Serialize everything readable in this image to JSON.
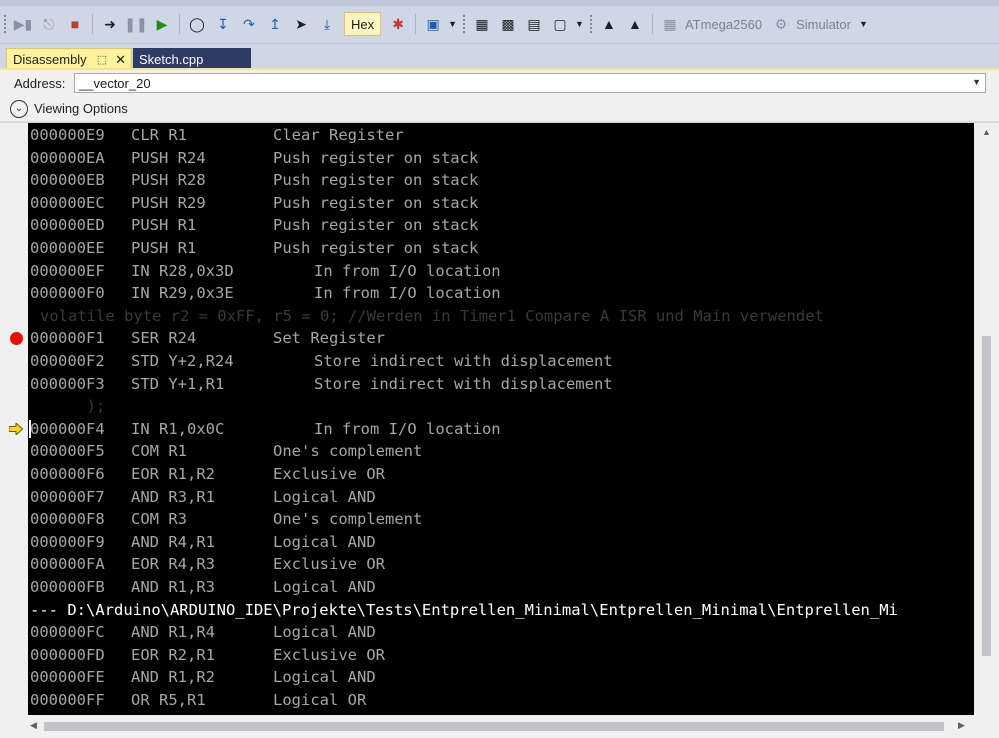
{
  "toolbar": {
    "hex_label": "Hex",
    "device": "ATmega2560",
    "tool": "Simulator",
    "icons": [
      "restart-icon",
      "step-icon",
      "stop-icon",
      "show-next-statement-icon",
      "pause-icon",
      "continue-icon",
      "watch-icon",
      "step-into-icon",
      "step-over-icon",
      "step-out-icon",
      "run-to-cursor-icon",
      "run-to-line-icon",
      "hex-toggle",
      "breakpoints-icon",
      "window-icon",
      "memory-icon",
      "registers-icon",
      "processor-icon",
      "io-view-icon",
      "program-icon",
      "erase-icon",
      "device-icon"
    ]
  },
  "tabs": [
    {
      "label": "Disassembly",
      "active": true
    },
    {
      "label": "Sketch.cpp",
      "active": false
    }
  ],
  "address": {
    "label": "Address:",
    "value": "__vector_20"
  },
  "viewing_options": {
    "label": "Viewing Options"
  },
  "lines": [
    {
      "type": "asm",
      "addr": "000000E9",
      "ins": "CLR R1",
      "desc": "Clear Register",
      "desc_col": "short"
    },
    {
      "type": "asm",
      "addr": "000000EA",
      "ins": "PUSH R24",
      "desc": "Push register on stack",
      "desc_col": "short"
    },
    {
      "type": "asm",
      "addr": "000000EB",
      "ins": "PUSH R28",
      "desc": "Push register on stack",
      "desc_col": "short"
    },
    {
      "type": "asm",
      "addr": "000000EC",
      "ins": "PUSH R29",
      "desc": "Push register on stack",
      "desc_col": "short"
    },
    {
      "type": "asm",
      "addr": "000000ED",
      "ins": "PUSH R1",
      "desc": "Push register on stack",
      "desc_col": "short"
    },
    {
      "type": "asm",
      "addr": "000000EE",
      "ins": "PUSH R1",
      "desc": "Push register on stack",
      "desc_col": "short"
    },
    {
      "type": "asm",
      "addr": "000000EF",
      "ins": "IN R28,0x3D",
      "desc": "In from I/O location",
      "desc_col": "long"
    },
    {
      "type": "asm",
      "addr": "000000F0",
      "ins": "IN R29,0x3E",
      "desc": "In from I/O location",
      "desc_col": "long"
    },
    {
      "type": "source",
      "text": "volatile byte r2 = 0xFF, r5 = 0; //Werden in Timer1 Compare A ISR und Main verwendet"
    },
    {
      "type": "asm",
      "addr": "000000F1",
      "ins": "SER R24",
      "desc": "Set Register",
      "desc_col": "short",
      "breakpoint": true
    },
    {
      "type": "asm",
      "addr": "000000F2",
      "ins": "STD Y+2,R24",
      "desc": "Store indirect with displacement",
      "desc_col": "long"
    },
    {
      "type": "asm",
      "addr": "000000F3",
      "ins": "STD Y+1,R1",
      "desc": "Store indirect with displacement",
      "desc_col": "long"
    },
    {
      "type": "source",
      "text": "     );"
    },
    {
      "type": "asm",
      "addr": "000000F4",
      "ins": "IN R1,0x0C",
      "desc": "In from I/O location",
      "desc_col": "long",
      "current": true
    },
    {
      "type": "asm",
      "addr": "000000F5",
      "ins": "COM R1",
      "desc": "One's complement",
      "desc_col": "short"
    },
    {
      "type": "asm",
      "addr": "000000F6",
      "ins": "EOR R1,R2",
      "desc": "Exclusive OR",
      "desc_col": "short"
    },
    {
      "type": "asm",
      "addr": "000000F7",
      "ins": "AND R3,R1",
      "desc": "Logical AND",
      "desc_col": "short"
    },
    {
      "type": "asm",
      "addr": "000000F8",
      "ins": "COM R3",
      "desc": "One's complement",
      "desc_col": "short"
    },
    {
      "type": "asm",
      "addr": "000000F9",
      "ins": "AND R4,R1",
      "desc": "Logical AND",
      "desc_col": "short"
    },
    {
      "type": "asm",
      "addr": "000000FA",
      "ins": "EOR R4,R3",
      "desc": "Exclusive OR",
      "desc_col": "short"
    },
    {
      "type": "asm",
      "addr": "000000FB",
      "ins": "AND R1,R3",
      "desc": "Logical AND",
      "desc_col": "short"
    },
    {
      "type": "file",
      "text": "--- D:\\Arduino\\ARDUINO_IDE\\Projekte\\Tests\\Entprellen_Minimal\\Entprellen_Minimal\\Entprellen_Mi"
    },
    {
      "type": "asm",
      "addr": "000000FC",
      "ins": "AND R1,R4",
      "desc": "Logical AND",
      "desc_col": "short"
    },
    {
      "type": "asm",
      "addr": "000000FD",
      "ins": "EOR R2,R1",
      "desc": "Exclusive OR",
      "desc_col": "short"
    },
    {
      "type": "asm",
      "addr": "000000FE",
      "ins": "AND R1,R2",
      "desc": "Logical AND",
      "desc_col": "short"
    },
    {
      "type": "asm",
      "addr": "000000FF",
      "ins": "OR R5,R1",
      "desc": "Logical OR",
      "desc_col": "short"
    }
  ]
}
